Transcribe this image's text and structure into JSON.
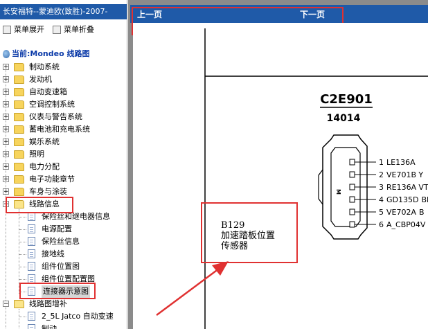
{
  "app": {
    "title": "长安福特--蒙迪欧(致胜)-2007-",
    "expand_label": "菜单展开",
    "collapse_label": "菜单折叠"
  },
  "current": "当前:Mondeo 线路图",
  "tree": [
    {
      "label": "制动系统",
      "expanded": false
    },
    {
      "label": "发动机",
      "expanded": false
    },
    {
      "label": "自动变速箱",
      "expanded": false
    },
    {
      "label": "空调控制系统",
      "expanded": false
    },
    {
      "label": "仪表与警告系统",
      "expanded": false
    },
    {
      "label": "蓄电池和充电系统",
      "expanded": false
    },
    {
      "label": "娱乐系统",
      "expanded": false
    },
    {
      "label": "照明",
      "expanded": false
    },
    {
      "label": "电力分配",
      "expanded": false
    },
    {
      "label": "电子功能章节",
      "expanded": false
    },
    {
      "label": "车身与涂装",
      "expanded": false
    },
    {
      "label": "线路信息",
      "expanded": true,
      "highlighted": true,
      "children": [
        "保险丝和继电器信息",
        "电源配置",
        "保险丝信息",
        "接地线",
        "组件位置图",
        "组件位置配置图",
        "连接器示意图"
      ],
      "selected_child": 6
    },
    {
      "label": "线路图增补",
      "expanded": true,
      "children": [
        "2_5L Jatco 自动变速",
        "制动"
      ]
    }
  ],
  "nav": {
    "prev": "上一页",
    "next": "下一页"
  },
  "diagram": {
    "connector_id": "C2E901",
    "part_number": "14014",
    "key_mark": "M",
    "pins": [
      {
        "num": "1",
        "signal": "LE136A",
        "extra": ""
      },
      {
        "num": "2",
        "signal": "VE701B",
        "extra": "Y"
      },
      {
        "num": "3",
        "signal": "RE136A",
        "extra": "VT"
      },
      {
        "num": "4",
        "signal": "GD135D",
        "extra": "BK"
      },
      {
        "num": "5",
        "signal": "VE702A",
        "extra": "B"
      },
      {
        "num": "6",
        "signal": "A_CBP04V",
        "extra": ""
      }
    ],
    "annotation": {
      "code": "B129",
      "line1": "加速踏板位置",
      "line2": "传感器"
    }
  },
  "colors": {
    "accent": "#1f5aa8",
    "highlight": "#e03131",
    "frame": "#8b8b8b"
  }
}
